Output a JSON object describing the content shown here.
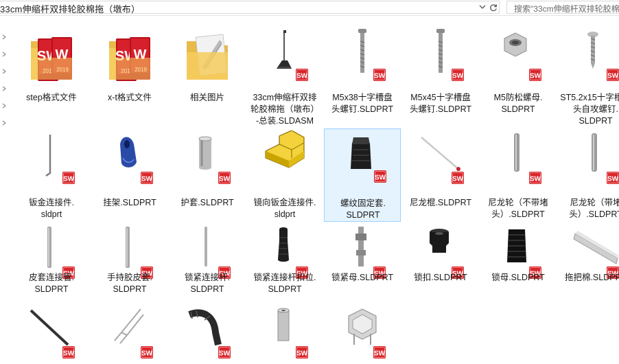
{
  "address_bar": {
    "path_text": "33cm伸缩杆双排轮胶棉拖（墩布）",
    "dropdown_icon": "chevron-down-icon",
    "refresh_icon": "refresh-icon"
  },
  "search": {
    "placeholder": "搜索\"33cm伸缩杆双排轮胶棉"
  },
  "files": [
    {
      "lines": [
        "step格式文件"
      ],
      "icon": "folder-sw-icon"
    },
    {
      "lines": [
        "x-t格式文件"
      ],
      "icon": "folder-sw-icon"
    },
    {
      "lines": [
        "相关图片"
      ],
      "icon": "folder-images-icon"
    },
    {
      "lines": [
        "33cm伸缩杆双排",
        "轮胶棉拖（墩布）",
        "-总装.SLDASM"
      ],
      "icon": "assembly-icon"
    },
    {
      "lines": [
        "M5x38十字槽盘",
        "头螺钉.SLDPRT"
      ],
      "icon": "screw-icon"
    },
    {
      "lines": [
        "M5x45十字槽盘",
        "头螺钉.SLDPRT"
      ],
      "icon": "screw-icon"
    },
    {
      "lines": [
        "M5防松螺母.",
        "SLDPRT"
      ],
      "icon": "nut-icon"
    },
    {
      "lines": [
        "ST5.2x15十字槽盘",
        "头自攻螺钉.",
        "SLDPRT"
      ],
      "icon": "tapping-screw-icon"
    },
    {
      "lines": [
        "钣金连接件.",
        "sldprt"
      ],
      "icon": "hook-part-icon"
    },
    {
      "lines": [
        "挂架.SLDPRT"
      ],
      "icon": "hanger-part-icon"
    },
    {
      "lines": [
        "护套.SLDPRT"
      ],
      "icon": "sleeve-part-icon"
    },
    {
      "lines": [
        "镜向钣金连接件.",
        "sldprt"
      ],
      "icon": "generic-part-icon"
    },
    {
      "lines": [
        "螺纹固定套.",
        "SLDPRT"
      ],
      "icon": "threaded-sleeve-icon"
    },
    {
      "lines": [
        "尼龙棍.SLDPRT"
      ],
      "icon": "nylon-rod-icon"
    },
    {
      "lines": [
        "尼龙轮（不带堵",
        "头）.SLDPRT"
      ],
      "icon": "roller-part-icon"
    },
    {
      "lines": [
        "尼龙轮（带堵",
        "头）.SLDPRT"
      ],
      "icon": "roller-part-icon"
    },
    {
      "lines": [
        "皮套连接管.",
        "SLDPRT"
      ],
      "icon": "tube-part-icon"
    },
    {
      "lines": [
        "手持胶皮套.",
        "SLDPRT"
      ],
      "icon": "tube-part-icon"
    },
    {
      "lines": [
        "锁紧连接杆.",
        "SLDPRT"
      ],
      "icon": "rod-part-icon"
    },
    {
      "lines": [
        "锁紧连接杆扣位.",
        "SLDPRT"
      ],
      "icon": "clip-part-icon"
    },
    {
      "lines": [
        "锁紧母.SLDPRT"
      ],
      "icon": "lock-nut-part-icon"
    },
    {
      "lines": [
        "锁扣.SLDPRT"
      ],
      "icon": "lock-cap-part-icon"
    },
    {
      "lines": [
        "锁母.SLDPRT"
      ],
      "icon": "ribbed-nut-part-icon"
    },
    {
      "lines": [
        "拖把棉.SLDPRT"
      ],
      "icon": "sponge-part-icon"
    },
    {
      "lines": [
        ""
      ],
      "icon": "black-rod-part-icon"
    },
    {
      "lines": [
        ""
      ],
      "icon": "wire-clip-part-icon"
    },
    {
      "lines": [
        ""
      ],
      "icon": "bent-tube-part-icon"
    },
    {
      "lines": [
        ""
      ],
      "icon": "short-tube-part-icon"
    },
    {
      "lines": [
        ""
      ],
      "icon": "bracket-part-icon"
    }
  ],
  "selected_index": 12,
  "colors": {
    "sw_badge": "#d9252a",
    "folder": "#f5c95a",
    "selection_border": "#99d1ff"
  }
}
